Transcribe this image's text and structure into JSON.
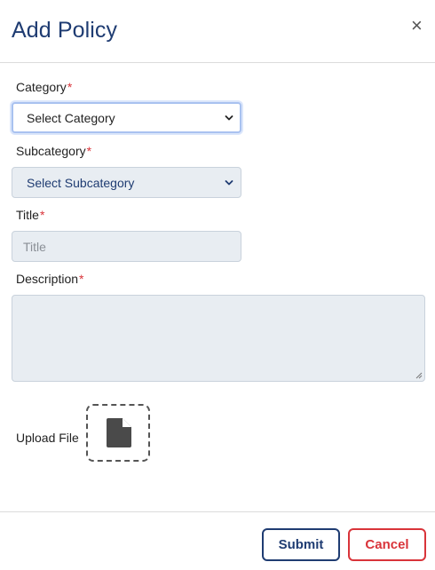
{
  "modal": {
    "title": "Add Policy",
    "close_symbol": "×"
  },
  "form": {
    "required_marker": "*",
    "category": {
      "label": "Category",
      "selected": "Select Category"
    },
    "subcategory": {
      "label": "Subcategory",
      "selected": "Select Subcategory"
    },
    "title_field": {
      "label": "Title",
      "placeholder": "Title"
    },
    "description": {
      "label": "Description",
      "value": ""
    },
    "upload": {
      "label": "Upload File",
      "icon": "file-icon"
    }
  },
  "footer": {
    "submit_label": "Submit",
    "cancel_label": "Cancel"
  },
  "colors": {
    "brand": "#1f3c72",
    "danger": "#d9343a",
    "field_bg": "#e8edf2"
  }
}
